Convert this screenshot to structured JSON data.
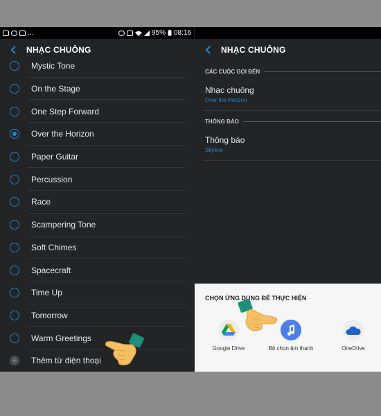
{
  "status_bar": {
    "battery": "95%",
    "time": "08:16",
    "dots": "..."
  },
  "left_screen": {
    "title": "NHẠC CHUÔNG",
    "ringtones": [
      {
        "label": "Mystic Tone",
        "selected": false
      },
      {
        "label": "On the Stage",
        "selected": false
      },
      {
        "label": "One Step Forward",
        "selected": false
      },
      {
        "label": "Over the Horizon",
        "selected": true
      },
      {
        "label": "Paper Guitar",
        "selected": false
      },
      {
        "label": "Percussion",
        "selected": false
      },
      {
        "label": "Race",
        "selected": false
      },
      {
        "label": "Scampering Tone",
        "selected": false
      },
      {
        "label": "Soft Chimes",
        "selected": false
      },
      {
        "label": "Spacecraft",
        "selected": false
      },
      {
        "label": "Time Up",
        "selected": false
      },
      {
        "label": "Tomorrow",
        "selected": false
      },
      {
        "label": "Warm Greetings",
        "selected": false
      }
    ],
    "add_from_phone": "Thêm từ điện thoại"
  },
  "right_screen": {
    "title": "NHẠC CHUÔNG",
    "calls_section": "CÁC CUỘC GỌI ĐẾN",
    "ringtone_setting": {
      "name": "Nhạc chuông",
      "value": "Over the Horizon"
    },
    "notif_section": "THÔNG BÁO",
    "notif_setting": {
      "name": "Thông báo",
      "value": "Skyline"
    },
    "sheet": {
      "title": "CHỌN ỨNG DỤNG ĐỂ THỰC HIỆN",
      "apps": [
        {
          "name": "Google Drive",
          "icon": "google-drive-icon"
        },
        {
          "name": "Bộ chọn âm thanh",
          "icon": "music-note-icon"
        },
        {
          "name": "OneDrive",
          "icon": "onedrive-icon"
        }
      ]
    }
  },
  "colors": {
    "accent": "#1e88d6",
    "background": "#222426",
    "sheet": "#f6f6f6"
  }
}
